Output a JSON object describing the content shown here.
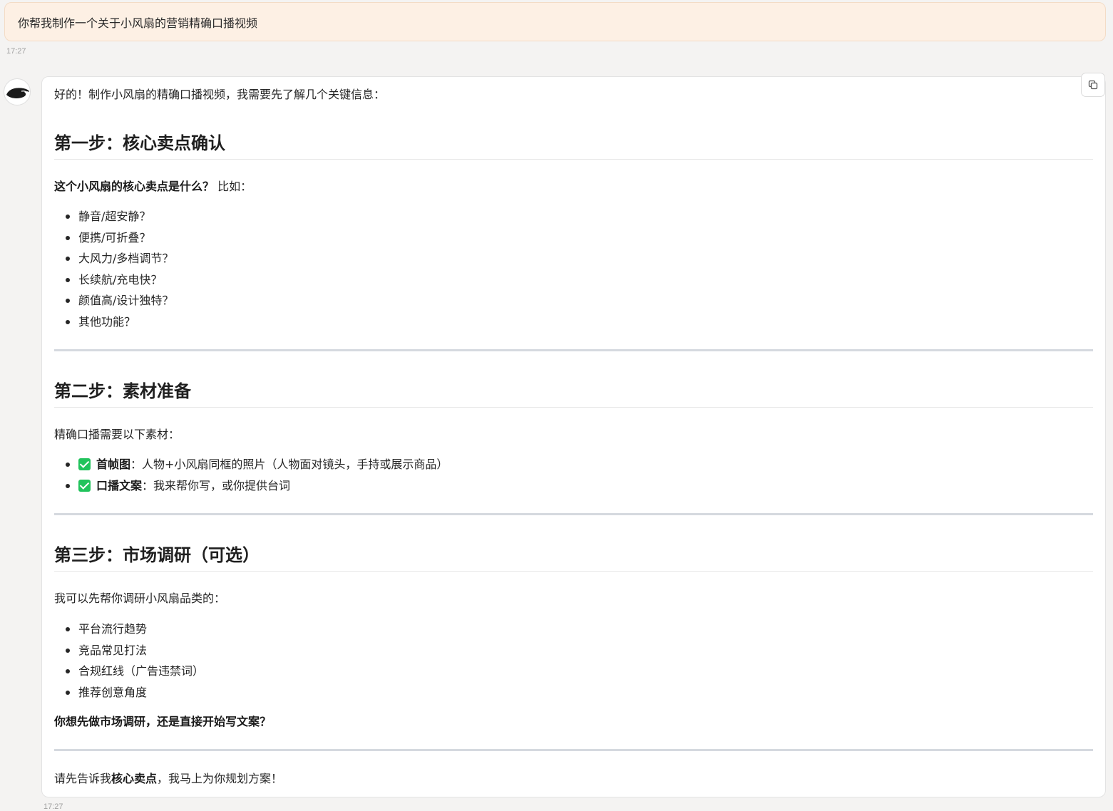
{
  "user_message": {
    "text": "你帮我制作一个关于小风扇的营销精确口播视频",
    "timestamp": "17:27"
  },
  "assistant_message": {
    "timestamp": "17:27",
    "copy_icon": "copy-icon",
    "avatar_icon": "assistant-logo-icon",
    "intro": "好的！制作小风扇的精确口播视频，我需要先了解几个关键信息：",
    "step1": {
      "heading": "第一步：核心卖点确认",
      "question_bold": "这个小风扇的核心卖点是什么？",
      "question_rest": " 比如：",
      "items": [
        "静音/超安静？",
        "便携/可折叠？",
        "大风力/多档调节？",
        "长续航/充电快？",
        "颜值高/设计独特？",
        "其他功能？"
      ]
    },
    "step2": {
      "heading": "第二步：素材准备",
      "intro": "精确口播需要以下素材：",
      "items": [
        {
          "label": "首帧图",
          "desc": "：人物+小风扇同框的照片（人物面对镜头，手持或展示商品）"
        },
        {
          "label": "口播文案",
          "desc": "：我来帮你写，或你提供台词"
        }
      ],
      "check_color": "#21c35c"
    },
    "step3": {
      "heading": "第三步：市场调研（可选）",
      "intro": "我可以先帮你调研小风扇品类的：",
      "items": [
        "平台流行趋势",
        "竞品常见打法",
        "合规红线（广告违禁词）",
        "推荐创意角度"
      ],
      "question": "你想先做市场调研，还是直接开始写文案？"
    },
    "closing": {
      "prefix": "请先告诉我",
      "bold": "核心卖点",
      "suffix": "，我马上为你规划方案！"
    }
  },
  "colors": {
    "background": "#f4f3f2",
    "user_bubble": "#fdf0e4",
    "card": "#ffffff",
    "rule": "#d5d9df"
  }
}
